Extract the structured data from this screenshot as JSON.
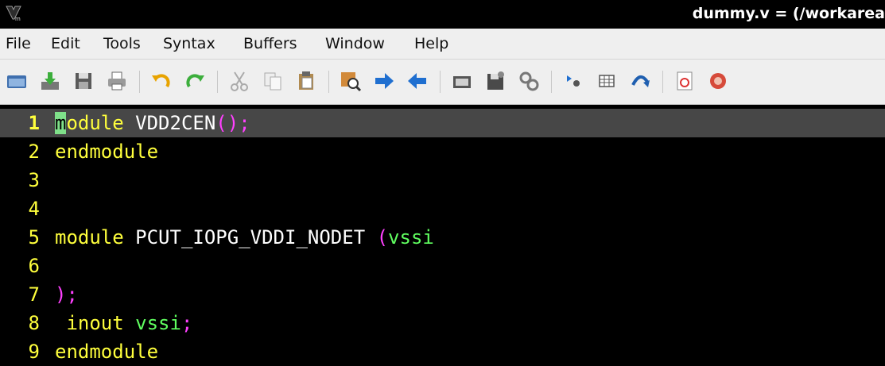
{
  "window": {
    "title": "dummy.v = (/workarea"
  },
  "menu": [
    "File",
    "Edit",
    "Tools",
    "Syntax",
    "Buffers",
    "Window",
    "Help"
  ],
  "toolbar_icons": [
    "open-folder-icon",
    "download-save-icon",
    "floppy-save-icon",
    "print-icon",
    "undo-icon",
    "redo-icon",
    "cut-icon",
    "copy-icon",
    "paste-icon",
    "find-replace-icon",
    "forward-arrow-icon",
    "back-arrow-icon",
    "load-session-icon",
    "save-session-icon",
    "run-script-icon",
    "make-icon",
    "table-icon",
    "jump-icon",
    "help-icon",
    "close-icon"
  ],
  "editor": {
    "line_numbers": [
      "1",
      "2",
      "3",
      "4",
      "5",
      "6",
      "7",
      "8",
      "9"
    ],
    "tokens": {
      "l1_cursor": "m",
      "l1_kw_rest": "odule",
      "l1_name": " VDD2CEN",
      "l1_punct": "();",
      "l2_kw": "endmodule",
      "l5_kw": "module",
      "l5_name": " PCUT_IOPG_VDDI_NODET ",
      "l5_paren": "(",
      "l5_sig": "vssi",
      "l7_punct": ");",
      "l8_indent": " ",
      "l8_kw": "inout",
      "l8_sig": " vssi",
      "l8_semi": ";",
      "l9_kw": "endmodule"
    }
  },
  "colors": {
    "keyword": "#ffff3c",
    "punctuation": "#ff40ff",
    "signal": "#60ff60",
    "line_number": "#ffff3c",
    "cursor_line": "#474747",
    "cursor": "#7fe08a"
  }
}
